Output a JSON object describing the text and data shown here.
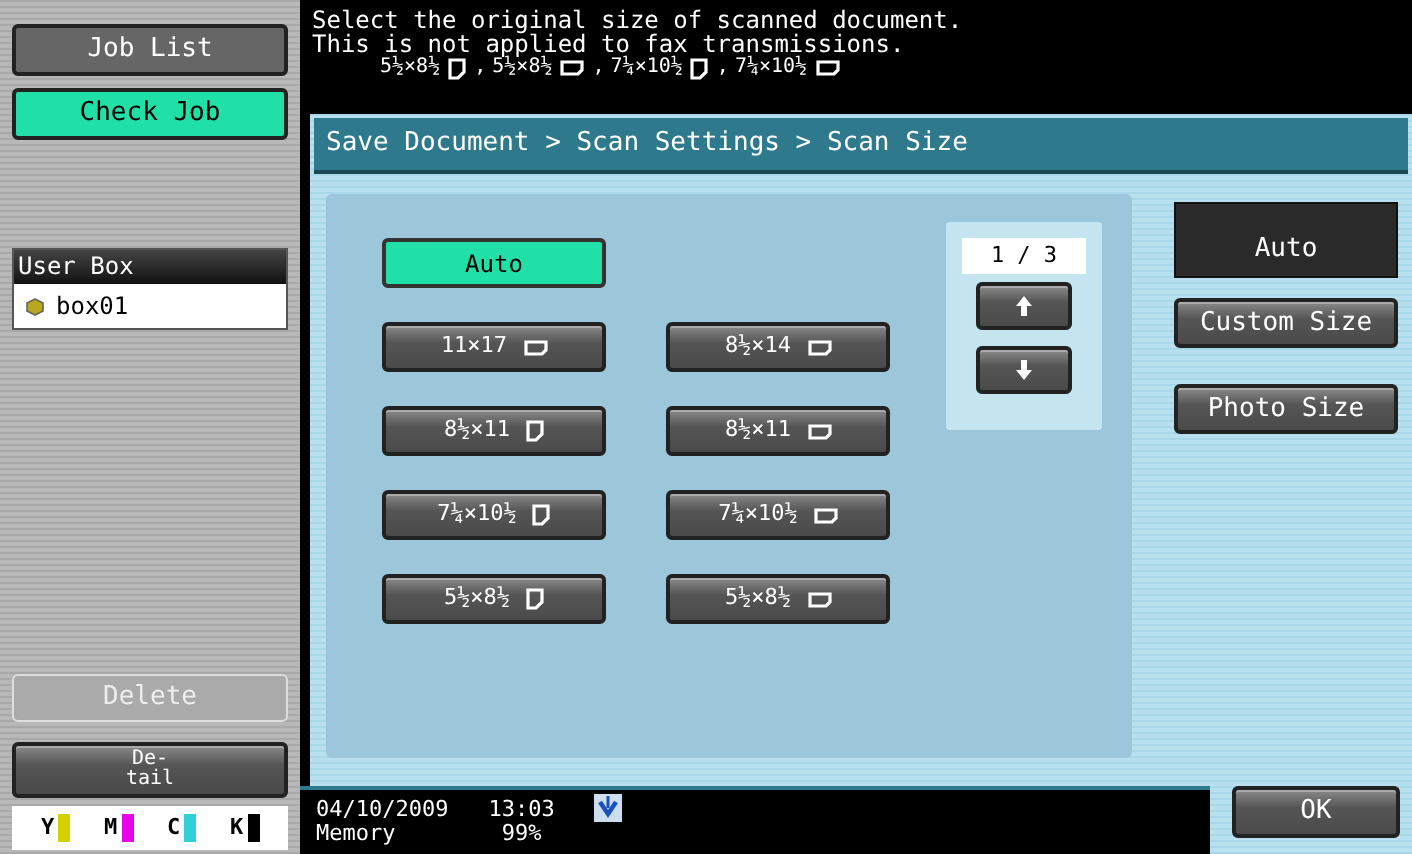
{
  "side": {
    "buttons": [
      {
        "label": "Job List",
        "active": false
      },
      {
        "label": "Check Job",
        "active": true
      }
    ],
    "user_box": {
      "title": "User Box",
      "items": [
        {
          "label": "box01",
          "selected": true
        }
      ]
    },
    "delete": {
      "label": "Delete",
      "disabled": true
    },
    "detail": {
      "lines": [
        "De-",
        "tail"
      ]
    },
    "toner": [
      {
        "label": "Y",
        "color": "#d4d000"
      },
      {
        "label": "M",
        "color": "#e800e8"
      },
      {
        "label": "C",
        "color": "#30d0d8"
      },
      {
        "label": "K",
        "color": "#000000"
      }
    ]
  },
  "message": {
    "lines": [
      "Select the original size of scanned document.",
      "This is not applied to fax transmissions."
    ],
    "sizes": [
      {
        "label": "5½×8½",
        "kind": "portrait",
        "separator": ","
      },
      {
        "label": "5½×8½",
        "kind": "landscape",
        "separator": ","
      },
      {
        "label": "7¼×10½",
        "kind": "portrait",
        "separator": ","
      },
      {
        "label": "7¼×10½",
        "kind": "landscape"
      }
    ]
  },
  "breadcrumb": "Save Document > Scan Settings > Scan Size",
  "auto": {
    "label": "Auto",
    "selected": true
  },
  "sizes": [
    {
      "label": "11×17",
      "kind": "landscape",
      "selected": false
    },
    {
      "label": "8½×14",
      "kind": "landscape",
      "selected": false
    },
    {
      "label": "8½×11",
      "kind": "portrait",
      "selected": false
    },
    {
      "label": "8½×11",
      "kind": "landscape",
      "selected": false
    },
    {
      "label": "7¼×10½",
      "kind": "portrait",
      "selected": false
    },
    {
      "label": "7¼×10½",
      "kind": "landscape",
      "selected": false
    },
    {
      "label": "5½×8½",
      "kind": "portrait",
      "selected": false
    },
    {
      "label": "5½×8½",
      "kind": "landscape",
      "selected": false
    }
  ],
  "pager": {
    "text": "1 / 3"
  },
  "current": "Auto",
  "options": [
    "Custom Size",
    "Photo Size"
  ],
  "status": {
    "date": "04/10/2009",
    "time": "13:03",
    "memory_label": "Memory",
    "memory_value": "99%"
  },
  "ok": "OK"
}
